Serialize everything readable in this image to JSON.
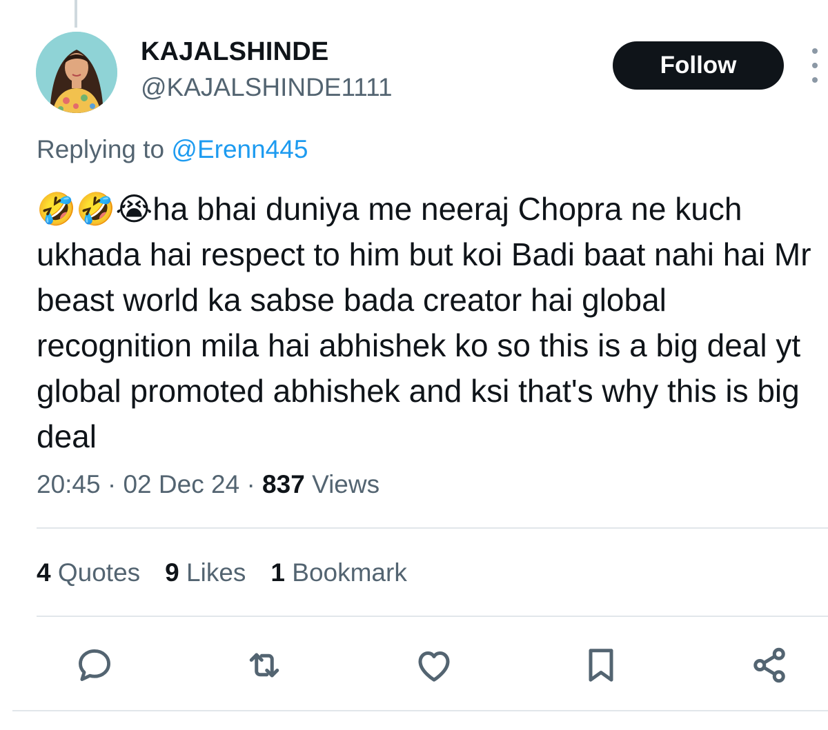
{
  "author": {
    "display_name": "KAJALSHINDE",
    "handle": "@KAJALSHINDE1111",
    "avatar": "avatar"
  },
  "header": {
    "follow_label": "Follow",
    "more_icon": "more-vertical-icon"
  },
  "reply": {
    "prefix": "Replying to ",
    "mention": "@Erenn445"
  },
  "tweet": {
    "text": "🤣🤣😭ha bhai duniya me neeraj Chopra ne kuch ukhada hai respect to him but koi Badi baat nahi hai Mr beast world ka sabse bada creator hai global recognition mila hai abhishek ko so this is a big deal yt global promoted abhishek and ksi that's why this is big deal",
    "time": "20:45",
    "date": "02 Dec 24",
    "sep": "·",
    "views_count": "837",
    "views_label": "Views"
  },
  "stats": [
    {
      "count": "4",
      "label": "Quotes"
    },
    {
      "count": "9",
      "label": "Likes"
    },
    {
      "count": "1",
      "label": "Bookmark"
    }
  ],
  "actions": [
    {
      "icon": "reply-icon"
    },
    {
      "icon": "retweet-icon"
    },
    {
      "icon": "like-icon"
    },
    {
      "icon": "bookmark-icon"
    },
    {
      "icon": "share-icon"
    }
  ],
  "colors": {
    "text": "#0f1419",
    "secondary": "#536471",
    "link": "#1d9bf0",
    "button_bg": "#0f1419",
    "divider": "#e1e6ea",
    "icon": "#536471"
  }
}
